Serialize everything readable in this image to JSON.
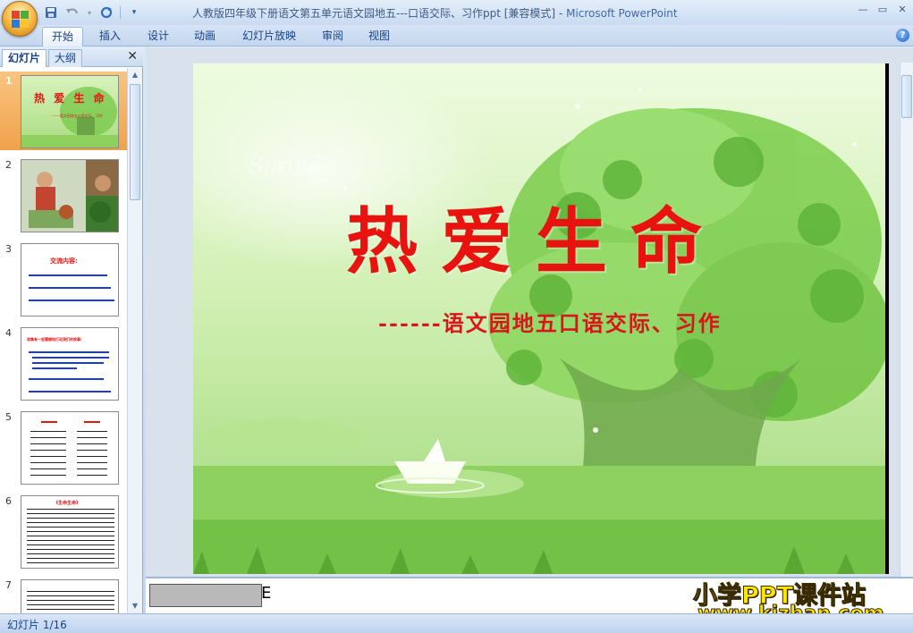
{
  "app": {
    "window_title": "人教版四年级下册语文第五单元语文园地五---口语交际、习作ppt [兼容模式]",
    "app_name": "Microsoft PowerPoint",
    "title_separator": " - "
  },
  "quick_access": {
    "icons": [
      "save-icon",
      "undo-icon",
      "redo-icon",
      "customize-icon"
    ]
  },
  "ribbon_tabs": [
    "开始",
    "插入",
    "设计",
    "动画",
    "幻灯片放映",
    "审阅",
    "视图"
  ],
  "active_tab": "开始",
  "slides_pane": {
    "tabs": [
      "幻灯片",
      "大纲"
    ],
    "active_tab": "幻灯片",
    "close_glyph": "✕",
    "thumbnails": [
      {
        "number": "1",
        "title": "热 爱 生 命",
        "subtitle": "------语文园地五口语交际、习作"
      },
      {
        "number": "2"
      },
      {
        "number": "3",
        "title": "交流内容:"
      },
      {
        "number": "4",
        "title": "收集有一些震撼和打动我们的故事:"
      },
      {
        "number": "5"
      },
      {
        "number": "6",
        "title": "《生命生命》"
      },
      {
        "number": "7"
      }
    ],
    "selected_slide": 1
  },
  "slide": {
    "title": "热爱生命",
    "subtitle": "------语文园地五口语交际、习作",
    "background_text": "Spring",
    "colors": {
      "title": "#e8120e",
      "subtitle": "#d8151a",
      "background": "#cfeeb0"
    }
  },
  "notes": {
    "text": "",
    "partial_glyph": "E"
  },
  "watermark": {
    "line1": "小学PPT课件站",
    "line2": "www.kjzhan.com"
  },
  "status": {
    "slide_indicator": "幻灯片 1/16"
  },
  "window_controls": [
    "minimize",
    "restore",
    "close"
  ]
}
